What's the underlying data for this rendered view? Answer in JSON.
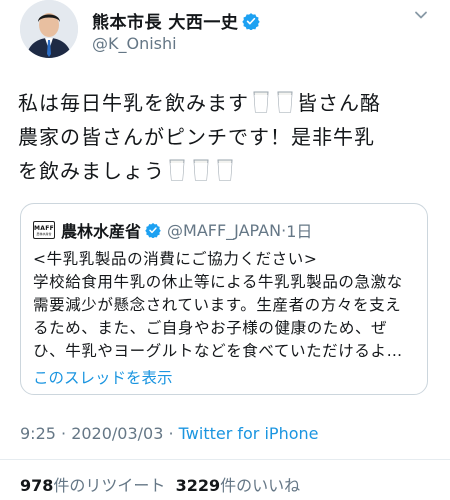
{
  "author": {
    "name": "熊本市長 大西一史",
    "handle": "@K_Onishi"
  },
  "tweet": {
    "line1": "私は毎日牛乳を飲みます",
    "line1_end": "皆さん酪",
    "line2": "農家の皆さんがピンチです！是非牛乳",
    "line3": "を飲みましょう"
  },
  "quoted": {
    "logo_text": "MAFF",
    "logo_subtext": "農林水産省",
    "name": "農林水産省",
    "handle": "@MAFF_JAPAN",
    "separator": "·",
    "time": "1日",
    "lines": [
      "<牛乳乳製品の消費にご協力ください>",
      "学校給食用牛乳の休止等による牛乳乳製品の急激な",
      "需要減少が懸念されています。生産者の方々を支え",
      "るため、また、ご自身やお子様の健康のため、ぜ",
      "ひ、牛乳やヨーグルトなどを食べていただけるよ…"
    ],
    "thread_link": "このスレッドを表示"
  },
  "meta": {
    "timestamp": "9:25 · 2020/03/03 · ",
    "source": "Twitter for iPhone"
  },
  "stats": {
    "retweets_count": "978",
    "retweets_label": "件のリツイート",
    "likes_count": "3229",
    "likes_label": "件のいいね"
  },
  "icons": {
    "verified": "verified-badge-icon",
    "chevron": "chevron-down-icon",
    "milk": "milk-glass-emoji"
  },
  "colors": {
    "verified_blue": "#1da1f2",
    "link_blue": "#1b95e0",
    "secondary_text": "#657786"
  }
}
